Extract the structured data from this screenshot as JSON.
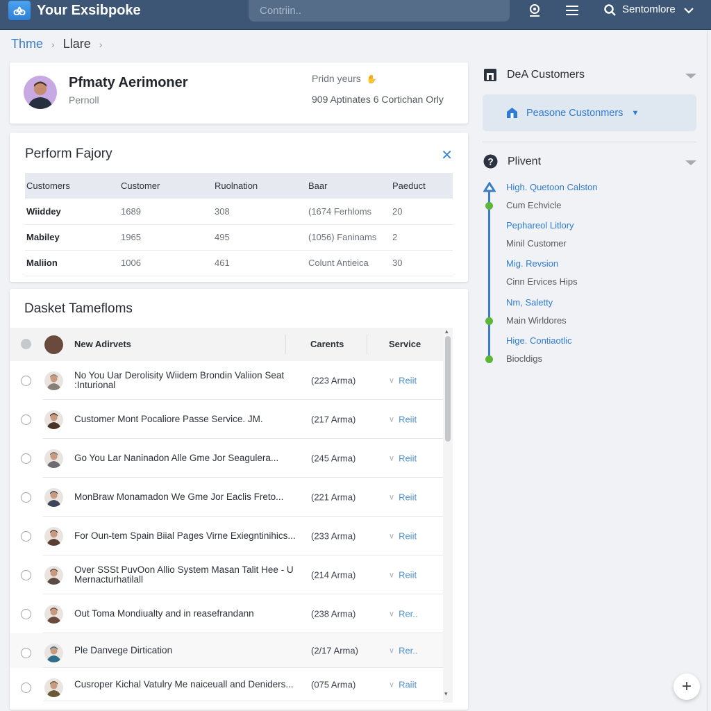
{
  "app": {
    "title": "Your Exsibpoke",
    "search_placeholder": "Contriin..",
    "user_name": "Sentomlore",
    "icons": [
      "logo-icon",
      "webcam-icon",
      "menu-icon",
      "search-icon",
      "chevron-down-icon"
    ]
  },
  "breadcrumb": {
    "items": [
      "Thme",
      "Llare"
    ]
  },
  "profile": {
    "name": "Pfmaty Aerimoner",
    "role": "Pernoll",
    "meta_line1": "Pridn yeurs",
    "meta_line2": "909 Aptinates 6 Cortichan Orly"
  },
  "performance": {
    "title": "Perform Fajory",
    "columns": [
      "Customers",
      "Customer",
      "Ruolnation",
      "Baar",
      "Paeduct"
    ],
    "rows": [
      [
        "Wiiddey",
        "1689",
        "308",
        "(1674 Ferhloms",
        "20"
      ],
      [
        "Mabiley",
        "1965",
        "495",
        "(1056) Faninams",
        "2"
      ],
      [
        "Maliion",
        "1006",
        "461",
        "Colunt Antieica",
        "30"
      ]
    ]
  },
  "list": {
    "title": "Dasket Tamefloms",
    "header": {
      "label": "New Adirvets",
      "col2": "Carents",
      "col3": "Service"
    },
    "rows": [
      {
        "text": "No You Uar Derolisity Wiidem Brondin Valiion Seat :Inturional",
        "count": "(223 Arma)",
        "action": "Reiit",
        "avatar_color": "#8a7f78"
      },
      {
        "text": "Customer Mont Pocaliore Passe Service. JM.",
        "count": "(217 Arma)",
        "action": "Reiit",
        "avatar_color": "#4a3428"
      },
      {
        "text": "Go You Lar Naninadon Alle Gme Jor Seagulera...",
        "count": "(245 Arma)",
        "action": "Reiit",
        "avatar_color": "#6d6a70"
      },
      {
        "text": "MonBraw Monamadon We Gme Jor Eaclis Freto...",
        "count": "(221 Arma)",
        "action": "Reiit",
        "avatar_color": "#3d4658"
      },
      {
        "text": "For Oun-tem Spain Biial Pages Virne Exiegntinihics...",
        "count": "(233 Arma)",
        "action": "Reiit",
        "avatar_color": "#5a3e34"
      },
      {
        "text": "Over SSSt PuvOon Allio System Masan Talit Hee - U Mernacturhatilall",
        "count": "(214 Arma)",
        "action": "Reiit",
        "avatar_color": "#5c4a44"
      },
      {
        "text": "Out Toma Mondiualty and in reasefrandann",
        "count": "(238 Arma)",
        "action": "Rer..",
        "avatar_color": "#6a4a3c"
      },
      {
        "text": "Ple Danvege Dirtication",
        "count": "(2/17 Arma)",
        "action": "Rer..",
        "avatar_color": "#2f6d8a"
      },
      {
        "text": "Cusroper Kichal Vatulry Me naiceuall and Deniders...",
        "count": "(075 Arma)",
        "action": "Raiit",
        "avatar_color": "#6b5a3a"
      }
    ]
  },
  "right_panel": {
    "section1": {
      "label": "DeA Customers"
    },
    "subitem": {
      "label": "Peasone Custonmers"
    },
    "section2": {
      "label": "Plivent"
    },
    "timeline": [
      {
        "label": "High. Quetoon Calston",
        "type": "link"
      },
      {
        "label": "Cum Echvicle",
        "type": "plain"
      },
      {
        "label": "Pephareol Litlory",
        "type": "link"
      },
      {
        "label": "Minil Customer",
        "type": "plain"
      },
      {
        "label": "Mig. Revsion",
        "type": "link"
      },
      {
        "label": "Cinn Ervices Hips",
        "type": "plain"
      },
      {
        "label": "Nm, Saletty",
        "type": "link"
      },
      {
        "label": "Main Wirldores",
        "type": "plain"
      },
      {
        "label": "Hige. Contiaotlic",
        "type": "link"
      },
      {
        "label": "Biocldigs",
        "type": "plain"
      }
    ]
  },
  "fab": {
    "label": "+"
  },
  "colors": {
    "topbar": "#3d5675",
    "accent": "#2f7bd1",
    "timeline_dot": "#5cb538"
  }
}
